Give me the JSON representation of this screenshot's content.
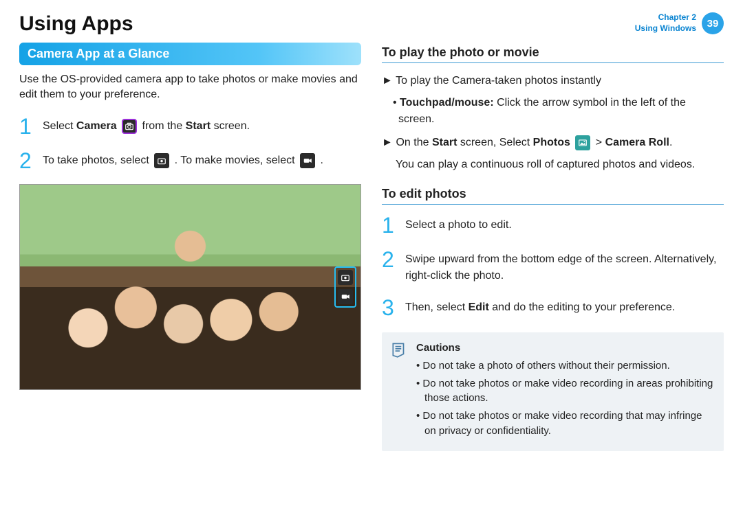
{
  "header": {
    "title": "Using Apps",
    "chapter_line1": "Chapter 2",
    "chapter_line2": "Using Windows",
    "page_number": "39"
  },
  "left": {
    "section_title": "Camera App at a Glance",
    "intro": "Use the OS-provided camera app to take photos or make movies and edit them to your preference.",
    "steps": [
      {
        "num": "1",
        "pre": "Select ",
        "bold1": "Camera",
        "mid": " from the ",
        "bold2": "Start",
        "post": " screen."
      },
      {
        "num": "2",
        "pre": "To take photos, select ",
        "mid": " . To make movies, select ",
        "post": " ."
      }
    ]
  },
  "right": {
    "play": {
      "heading": "To play the photo or movie",
      "item1_pre": "To play the Camera-taken photos instantly",
      "item1_sub_bold": "Touchpad/mouse:",
      "item1_sub_rest": " Click the arrow symbol in the left of the screen.",
      "item2_pre": "On the ",
      "item2_b1": "Start",
      "item2_mid1": " screen, Select ",
      "item2_b2": "Photos",
      "item2_mid2": " > ",
      "item2_b3": "Camera Roll",
      "item2_post": ".",
      "item2_sub": "You can play a continuous roll of captured photos and videos."
    },
    "edit": {
      "heading": "To edit photos",
      "steps": [
        {
          "num": "1",
          "text": "Select a photo to edit."
        },
        {
          "num": "2",
          "text": "Swipe upward from the bottom edge of the screen. Alternatively, right-click the photo."
        },
        {
          "num": "3",
          "pre": "Then, select ",
          "bold": "Edit",
          "post": " and do the editing to your preference."
        }
      ]
    },
    "cautions": {
      "title": "Cautions",
      "items": [
        "Do not take a photo of others without their permission.",
        "Do not take photos or make video recording in areas prohibiting those actions.",
        "Do not take photos or make video recording that may infringe on privacy or confidentiality."
      ]
    }
  }
}
